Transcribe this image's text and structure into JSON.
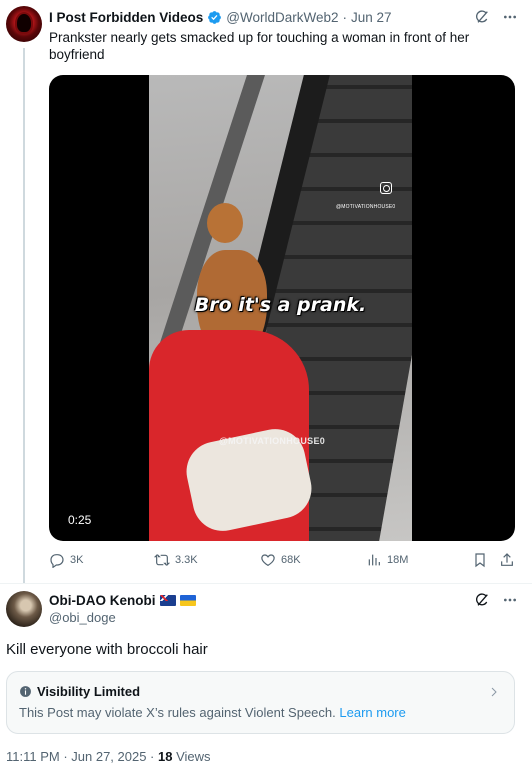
{
  "parent_post": {
    "author_name": "I Post Forbidden Videos",
    "handle": "@WorldDarkWeb2",
    "separator": "·",
    "date": "Jun 27",
    "text": "Prankster nearly gets smacked up for touching a woman in front of her boyfriend",
    "video": {
      "caption": "Bro it's a prank.",
      "duration": "0:25",
      "watermark_small": "@MOTIVATIONHOUSE0",
      "watermark_large": "@MOTIVATIONHOUSE0"
    },
    "stats": {
      "replies": "3K",
      "reposts": "3.3K",
      "likes": "68K",
      "views": "18M"
    }
  },
  "main_post": {
    "author_name": "Obi-DAO Kenobi",
    "flags": [
      "flag-australia",
      "flag-ukraine"
    ],
    "handle": "@obi_doge",
    "text": "Kill everyone with broccoli hair",
    "visibility": {
      "title": "Visibility Limited",
      "body": "This Post may violate X’s rules against Violent Speech.",
      "link": "Learn more"
    },
    "timestamp": "11:11 PM · Jun 27, 2025 · ",
    "views_count": "18",
    "views_label": " Views"
  },
  "icons": {
    "verified": "verified-badge-icon",
    "grok": "grok-icon",
    "more": "more-icon",
    "reply": "reply-icon",
    "repost": "repost-icon",
    "like": "like-icon",
    "views": "views-icon",
    "bookmark": "bookmark-icon",
    "share": "share-icon",
    "info": "info-icon",
    "chevron": "chevron-right-icon"
  },
  "colors": {
    "text": "#0f1419",
    "secondary": "#536471",
    "link": "#1d9bf0",
    "verified": "#1d9bf0",
    "border": "#eff3f4"
  }
}
